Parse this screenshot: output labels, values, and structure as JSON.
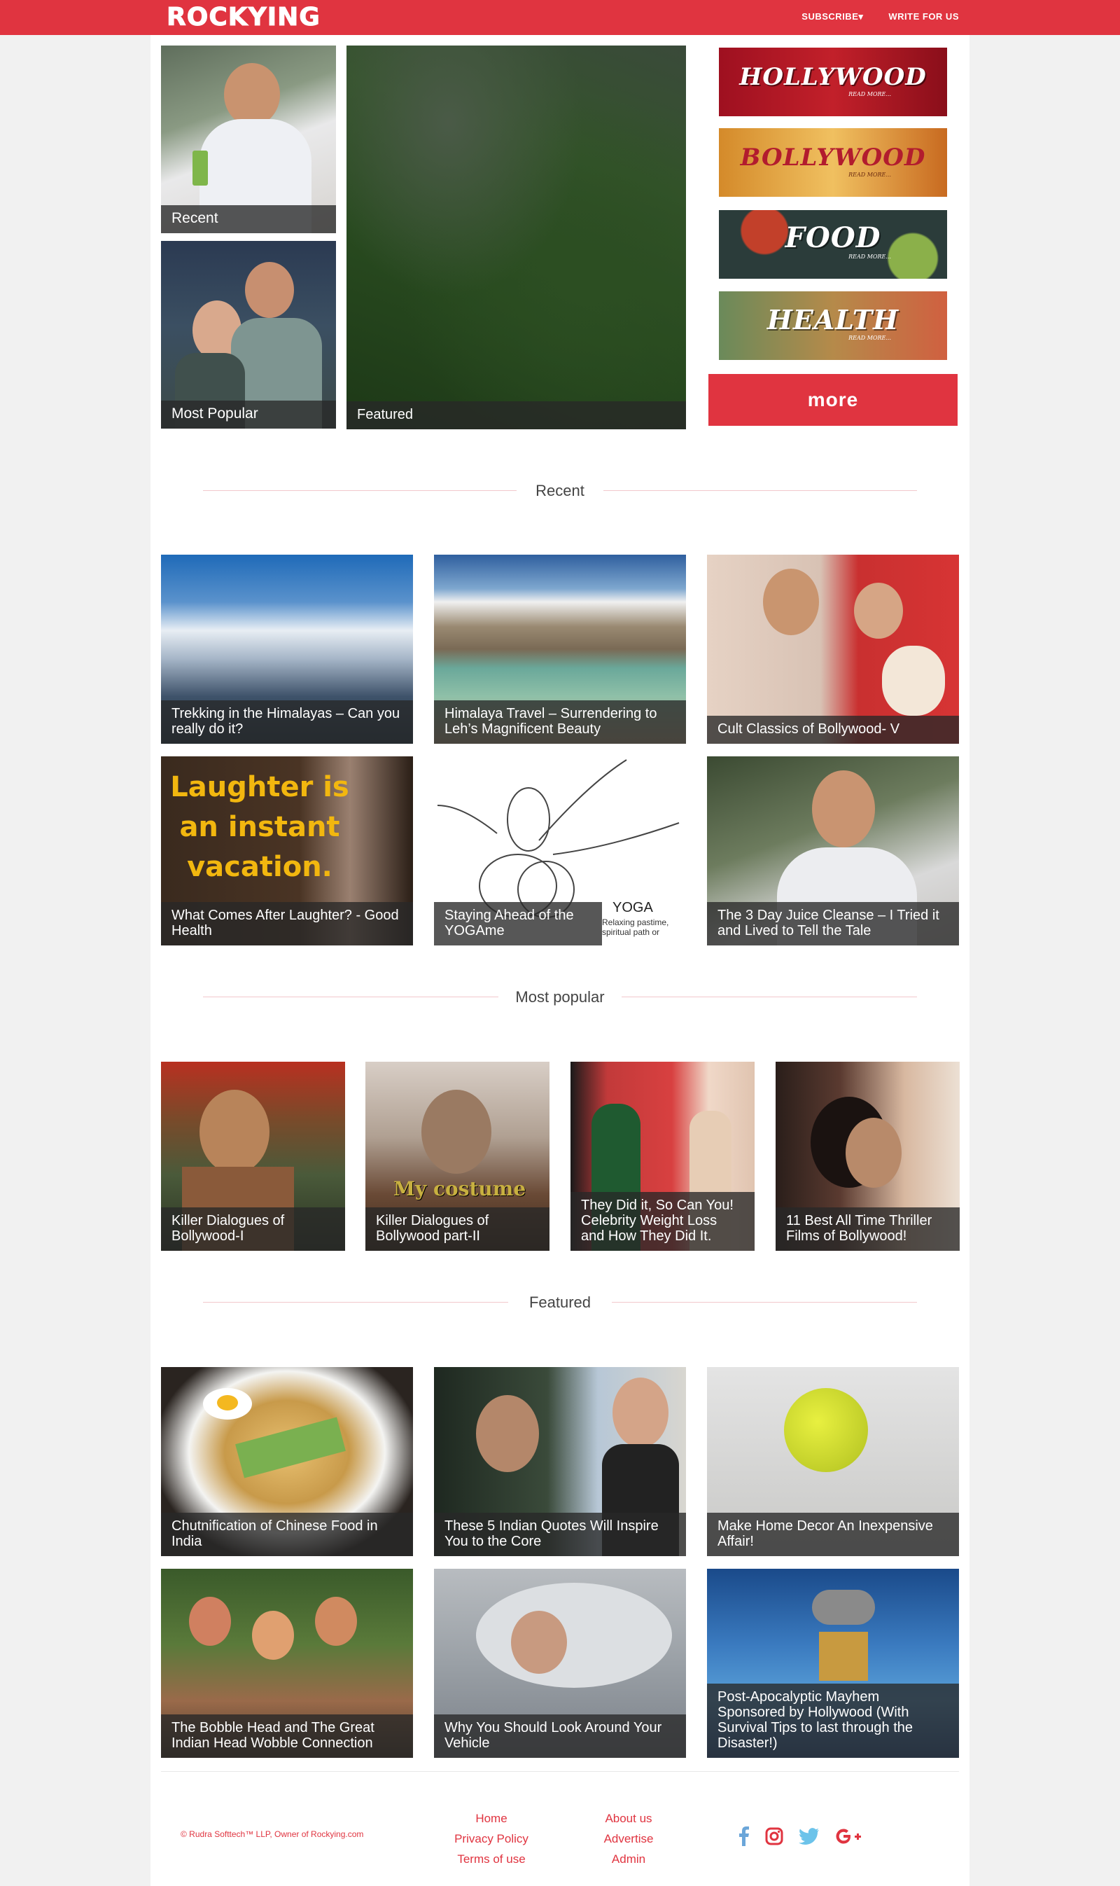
{
  "header": {
    "logo_text": "ROCKYING",
    "nav": [
      {
        "label": "SUBSCRIBE▾"
      },
      {
        "label": "WRITE FOR US"
      }
    ]
  },
  "hero": {
    "recent_label": "Recent",
    "popular_label": "Most Popular",
    "featured_label": "Featured"
  },
  "banners": [
    {
      "title": "HOLLYWOOD",
      "sub": "READ MORE..."
    },
    {
      "title": "BOLLYWOOD",
      "sub": "READ MORE..."
    },
    {
      "title": "FOOD",
      "sub": "READ MORE..."
    },
    {
      "title": "HEALTH",
      "sub": "READ MORE..."
    }
  ],
  "more_button": "more",
  "sections": {
    "recent": "Recent",
    "popular": "Most popular",
    "featured": "Featured"
  },
  "recent_posts": [
    "Trekking in the Himalayas – Can you really do it?",
    "Himalaya Travel – Surrendering to Leh’s Magnificent Beauty",
    "Cult Classics of Bollywood- V",
    "What Comes After Laughter? - Good Health",
    "Staying Ahead of the YOGAme",
    "The 3 Day Juice Cleanse – I Tried it and Lived to Tell the Tale"
  ],
  "laughter_image_text": "Laughter is an instant vacation.",
  "yoga_image_text": {
    "title": "YOGA",
    "sub": "Relaxing pastime, spiritual path or"
  },
  "popular_posts": [
    "Killer Dialogues of Bollywood-I",
    "Killer Dialogues of Bollywood part-II",
    "They Did it, So Can You! Celebrity Weight Loss and How They Did It.",
    "11 Best All Time Thriller Films of Bollywood!"
  ],
  "costume_image_text": "My costume",
  "featured_posts": [
    "Chutnification of Chinese Food in India",
    "These 5 Indian Quotes Will Inspire You to the Core",
    "Make Home Decor An Inexpensive Affair!",
    "The Bobble Head and The Great Indian Head Wobble Connection",
    "Why You Should Look Around Your Vehicle",
    "Post-Apocalyptic Mayhem Sponsored by Hollywood (With Survival Tips to last through the Disaster!)"
  ],
  "footer": {
    "copyright": "© Rudra Softtech™ LLP, Owner of Rockying.com",
    "col1": [
      "Home",
      "Privacy Policy",
      "Terms of use"
    ],
    "col2": [
      "About us",
      "Advertise",
      "Admin"
    ],
    "social_icons": [
      "facebook-icon",
      "instagram-icon",
      "twitter-icon",
      "google-plus-icon"
    ],
    "colors": {
      "facebook": "#6ba6d9",
      "instagram": "#e03440",
      "twitter": "#6cc3ea",
      "google": "#e03440"
    }
  },
  "colors": {
    "brand": "#e03440",
    "caption_bg": "rgba(40,40,40,0.78)"
  }
}
